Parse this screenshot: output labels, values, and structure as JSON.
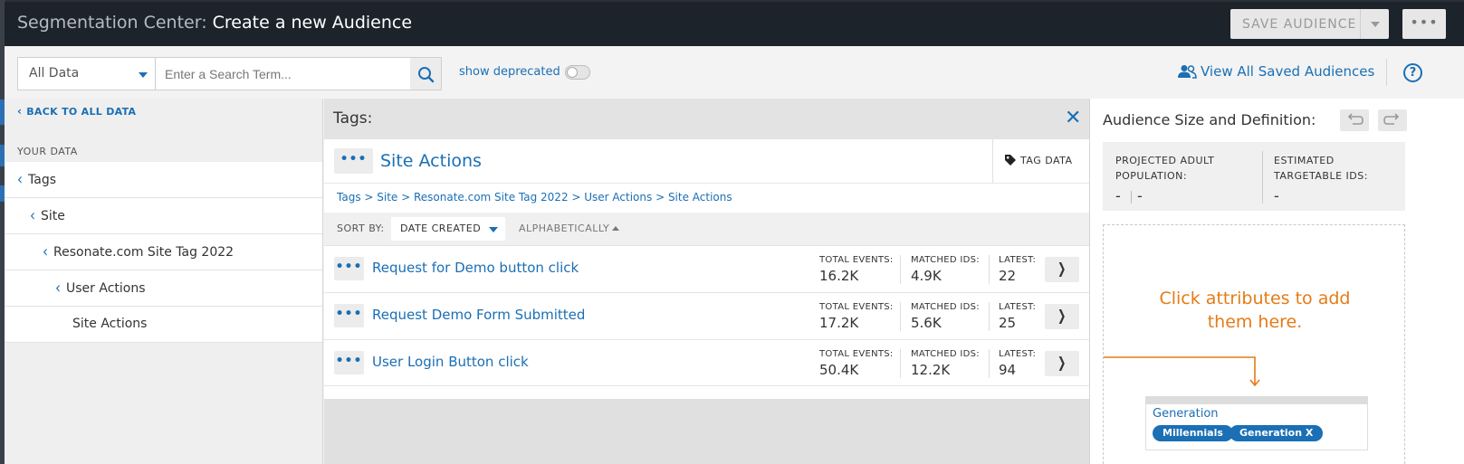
{
  "header": {
    "title_prefix": "Segmentation Center:",
    "title": "Create a new Audience",
    "save_label": "SAVE AUDIENCE",
    "more_label": "•••"
  },
  "search": {
    "data_filter": "All Data",
    "placeholder": "Enter a Search Term...",
    "show_deprecated_label": "show deprecated",
    "show_deprecated_on": false,
    "view_all_label": "View All Saved Audiences",
    "help_label": "?"
  },
  "sidebar": {
    "back_label": "BACK TO ALL DATA",
    "section_label": "YOUR DATA",
    "items": [
      {
        "label": "Tags",
        "expanded": true
      },
      {
        "label": "Site",
        "expanded": true
      },
      {
        "label": "Resonate.com Site Tag 2022",
        "expanded": true
      },
      {
        "label": "User Actions",
        "expanded": true
      },
      {
        "label": "Site Actions",
        "expanded": false
      }
    ]
  },
  "tags_panel": {
    "title": "Tags:",
    "group_title": "Site Actions",
    "tag_data_label": "TAG DATA",
    "breadcrumb": "Tags > Site > Resonate.com Site Tag 2022 > User Actions > Site Actions",
    "sort_by_label": "SORT BY:",
    "sort_date_label": "DATE CREATED",
    "sort_alpha_label": "ALPHABETICALLY",
    "stat_labels": {
      "total": "TOTAL EVENTS:",
      "matched": "MATCHED IDS:",
      "latest": "LATEST:"
    },
    "rows": [
      {
        "name": "Request for Demo button click",
        "total": "16.2K",
        "matched": "4.9K",
        "latest": "22"
      },
      {
        "name": "Request Demo Form Submitted",
        "total": "17.2K",
        "matched": "5.6K",
        "latest": "25"
      },
      {
        "name": "User Login Button click",
        "total": "50.4K",
        "matched": "12.2K",
        "latest": "94"
      }
    ]
  },
  "audience_panel": {
    "title": "Audience Size and Definition:",
    "projected_label": "PROJECTED ADULT POPULATION:",
    "projected_value_a": "-",
    "projected_value_b": "-",
    "targetable_label": "ESTIMATED TARGETABLE IDS:",
    "targetable_value": "-",
    "hint": "Click attributes to add them here.",
    "example_title": "Generation",
    "example_pills": [
      "Millennials",
      "Generation X"
    ]
  },
  "colors": {
    "accent": "#1a6fb5",
    "hint": "#e47b16",
    "header_bg": "#1d232b"
  }
}
